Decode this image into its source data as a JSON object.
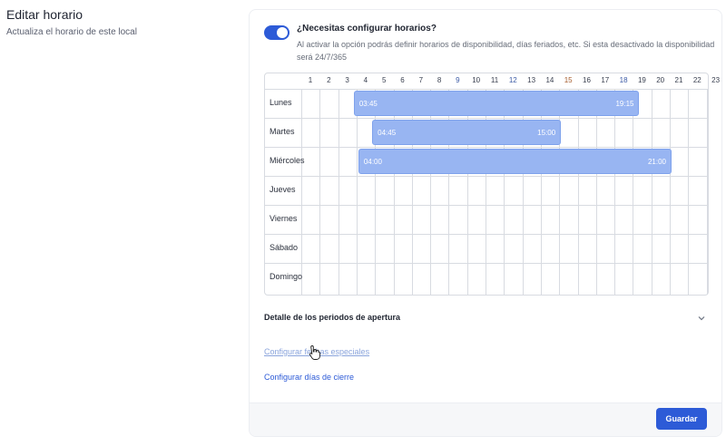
{
  "page": {
    "title": "Editar horario",
    "subtitle": "Actualiza el horario de este local"
  },
  "toggle": {
    "enabled": true,
    "title": "¿Necesitas configurar horarios?",
    "description": "Al activar la opción podrás definir horarios de disponibilidad, días feriados, etc. Si esta desactivado la disponibilidad será 24/7/365"
  },
  "schedule": {
    "hours": [
      "1",
      "2",
      "3",
      "4",
      "5",
      "6",
      "7",
      "8",
      "9",
      "10",
      "11",
      "12",
      "13",
      "14",
      "15",
      "16",
      "17",
      "18",
      "19",
      "20",
      "21",
      "22",
      "23"
    ],
    "days": [
      {
        "label": "Lunes",
        "start": "03:45",
        "end": "19:15"
      },
      {
        "label": "Martes",
        "start": "04:45",
        "end": "15:00"
      },
      {
        "label": "Miércoles",
        "start": "04:00",
        "end": "21:00"
      },
      {
        "label": "Jueves"
      },
      {
        "label": "Viernes"
      },
      {
        "label": "Sábado"
      },
      {
        "label": "Domingo"
      }
    ],
    "bar_color": "#98b5f2"
  },
  "detail": {
    "title": "Detalle de los periodos de apertura"
  },
  "links": {
    "special_dates": "Configurar fechas especiales",
    "closed_days": "Configurar días de cierre"
  },
  "footer": {
    "save_label": "Guardar"
  },
  "colors": {
    "accent": "#2d5bd7"
  }
}
